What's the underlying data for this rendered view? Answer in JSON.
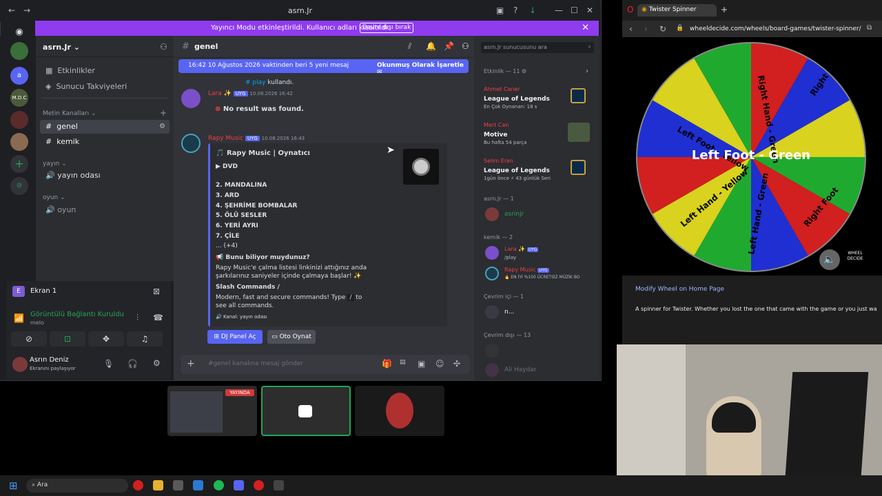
{
  "discord": {
    "window_title": "asrn.Jr",
    "banner": {
      "text": "Yayıncı Modu etkinleştirildi. Kullanıcı adları kısaltıldı.",
      "button": "Devre dışı bırak"
    },
    "rail": {
      "active_server_letter": "a",
      "mdc_label": "M.D.C"
    },
    "server_name": "asrn.Jr",
    "nav": {
      "events": "Etkinlikler",
      "boosts": "Sunucu Takviyeleri"
    },
    "categories": {
      "text": "Metin Kanalları",
      "yayin": "yayın",
      "oyun": "oyun"
    },
    "channels": {
      "genel": "genel",
      "kemik": "kemik",
      "yayin_odasi": "yayın odası",
      "oyun": "oyun"
    },
    "voice_panel": {
      "screen_label": "Ekran 1",
      "status": "Görüntülü Bağlantı Kuruldu",
      "channel": "melo"
    },
    "user": {
      "name": "Asrın Deniz",
      "status": "Ekranını paylaşıyor"
    },
    "chat": {
      "channel": "genel",
      "new_messages": "16:42 10 Ağustos 2026 vaktinden beri 5 yeni mesaj",
      "mark_read": "Okunmuş Olarak İşaretle",
      "msg1_used": "kullandı.",
      "msg1_command": "play",
      "msg1_tag": "UYG",
      "msg1_time": "10.08.2026 16:42",
      "msg1_body": "No result was found.",
      "msg2_tag": "UYG",
      "msg2_time": "10.08.2026 16:43",
      "embed": {
        "title": "Rapy Music | Oynatıcı",
        "dvd": "▶ DVD",
        "tracks": [
          "2. MANDALINA",
          "3. ARD",
          "4. ŞEHRİME BOMBALAR",
          "5. ÖLÜ SESLER",
          "6. YERİ AYRI",
          "7. ÇİLE"
        ],
        "more": "... (+4)",
        "did_you_know": "Bunu biliyor muydunuz?",
        "dyk_text": "Rapy Music'e çalma listesi linkinizi attığınız anda şarkılarınız saniyeler içinde çalmaya başlar! ✨",
        "slash_title": "Slash Commands /",
        "slash_text_a": "Modern, fast and secure commands! Type",
        "slash_key": "/",
        "slash_text_b": "to see all commands.",
        "channel_line": "Kanal: yayın odası"
      },
      "buttons": {
        "dj_panel": "DJ Panel Aç",
        "auto_play": "Oto Oynat"
      },
      "input_placeholder": "#genel kanalına mesaj gönder"
    },
    "members": {
      "search_placeholder": "asrn.Jr sunucusunu ara",
      "activity_header": "Etkinlik — 11",
      "activities": [
        {
          "game": "League of Legends",
          "sub": "En Çok Oynanan: 18 s"
        },
        {
          "game": "Motive",
          "sub": "Bu hafta 54 parça"
        },
        {
          "game": "League of Legends",
          "sub": "1gün önce ⚡ 43 günlük Seri"
        }
      ],
      "role1_header": "asrn.Jr — 1",
      "role1_member": "asrinjr",
      "role2_header": "kemik — 2",
      "role2_m1_sub": "/play",
      "role2_m1_tag": "UYG",
      "role2_m2_tag": "UYG",
      "role2_m2_sub": "EN İYİ %100 ÜCRETSİZ MÜZİK BO",
      "online_header": "Çevrim içi — 1",
      "online_member": "n...",
      "offline_header": "Çevrim dışı — 13",
      "offline_member": "Ali Haydar"
    }
  },
  "browser": {
    "tab_title": "Twister Spinner",
    "url": "wheeldecide.com/wheels/board-games/twister-spinner/",
    "wheel_result": "Left Foot - Green",
    "wheel_labels": [
      "Right Hand - Green",
      "Right Hand",
      "Left Foot - Yellow",
      "Left Hand - Yellow",
      "Left Hand - Green",
      "Right Foot"
    ],
    "logo": "WHEEL DECIDE",
    "modify_link": "Modify Wheel on Home Page",
    "description": "A spinner for Twister. Whether you lost the one that came with the game or you just wa"
  },
  "stream": {
    "live_badge": "YAYINDA"
  },
  "taskbar": {
    "search": "Ara"
  },
  "colors": {
    "blurple": "#5865f2",
    "banner": "#8f3bf0",
    "green": "#23a55a"
  }
}
